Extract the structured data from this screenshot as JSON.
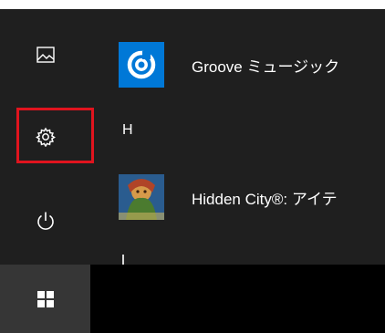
{
  "sidebar": {
    "pictures_icon": "pictures-icon",
    "settings_icon": "gear-icon",
    "power_icon": "power-icon"
  },
  "apps": [
    {
      "label": "Groove ミュージック",
      "icon": "groove-music-icon",
      "tile_color": "#0078d7"
    },
    {
      "label": "Hidden City®: アイテ",
      "icon": "hidden-city-icon",
      "tile_color": "#0a3f7a"
    }
  ],
  "section_letter": "H",
  "taskbar": {
    "start_icon": "windows-logo-icon"
  },
  "colors": {
    "start_menu_bg": "#1f1f1f",
    "taskbar": "#000000",
    "start_button_bg": "#363636",
    "highlight": "#e0141e",
    "accent": "#0078d7"
  }
}
